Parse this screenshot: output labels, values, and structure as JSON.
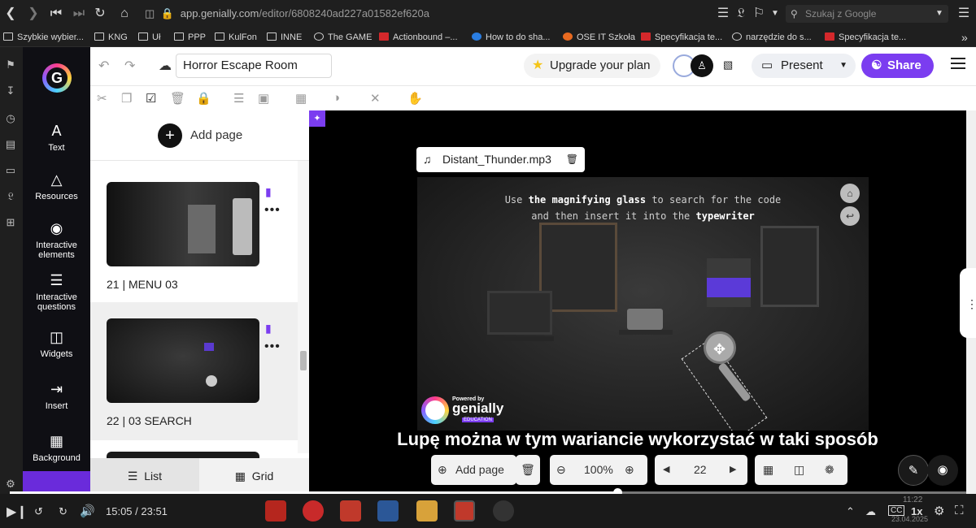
{
  "browser": {
    "url_host": "app.genially.com",
    "url_path": "/editor/6808240ad227a01582ef620a",
    "search_placeholder": "Szukaj z Google"
  },
  "bookmarks": [
    {
      "label": "Szybkie wybier...",
      "icon": "apps-icon"
    },
    {
      "label": "KNG",
      "icon": "folder-icon"
    },
    {
      "label": "Uł",
      "icon": "folder-icon"
    },
    {
      "label": "PPP",
      "icon": "folder-icon"
    },
    {
      "label": "KulFon",
      "icon": "folder-icon"
    },
    {
      "label": "INNE",
      "icon": "folder-icon"
    },
    {
      "label": "The GAME",
      "icon": "globe-icon"
    },
    {
      "label": "Actionbound –...",
      "icon": "actionbound-icon"
    },
    {
      "label": "How to do sha...",
      "icon": "drop-icon"
    },
    {
      "label": "OSE IT Szkoła",
      "icon": "ose-icon"
    },
    {
      "label": "Specyfikacja te...",
      "icon": "ms-icon"
    },
    {
      "label": "narzędzie do s...",
      "icon": "google-icon"
    },
    {
      "label": "Specyfikacja te...",
      "icon": "ms-icon"
    }
  ],
  "sidebar": {
    "items": [
      {
        "label": "Text",
        "icon": "text-icon"
      },
      {
        "label": "Resources",
        "icon": "resources-icon"
      },
      {
        "label": "Interactive elements",
        "icon": "interactive-elements-icon"
      },
      {
        "label": "Interactive questions",
        "icon": "interactive-questions-icon"
      },
      {
        "label": "Widgets",
        "icon": "widgets-icon"
      },
      {
        "label": "Insert",
        "icon": "insert-icon"
      },
      {
        "label": "Background",
        "icon": "background-icon"
      }
    ]
  },
  "topbar": {
    "title": "Horror Escape Room",
    "upgrade": "Upgrade your plan",
    "present": "Present",
    "share": "Share"
  },
  "pages": {
    "add_page": "Add page",
    "items": [
      {
        "label": "21 |  MENU 03"
      },
      {
        "label": "22 |  03 SEARCH"
      }
    ],
    "list": "List",
    "grid": "Grid"
  },
  "canvas": {
    "audio_file": "Distant_Thunder.mp3",
    "instruction_line1_pre": "Use ",
    "instruction_line1_bold": "the magnifying glass",
    "instruction_line1_post": " to search for the code",
    "instruction_line2_pre": "and then insert it into the ",
    "instruction_line2_bold": "typewriter",
    "badge_powered": "Powered by",
    "badge_name": "genially",
    "badge_edu": "EDUCATION",
    "subtitle": "Lupę można w tym wariancie wykorzystać w taki sposób"
  },
  "bottom_toolbar": {
    "add_page": "Add page",
    "zoom": "100%",
    "page_number": "22"
  },
  "player": {
    "time": "15:05 / 23:51",
    "speed": "1x",
    "progress_fraction": 0.635,
    "clock": "11:22",
    "date": "23.04.2025"
  },
  "colors": {
    "accent": "#7b3df0",
    "sidebar_bg": "#0f0f14",
    "canvas_bg": "#000000"
  }
}
